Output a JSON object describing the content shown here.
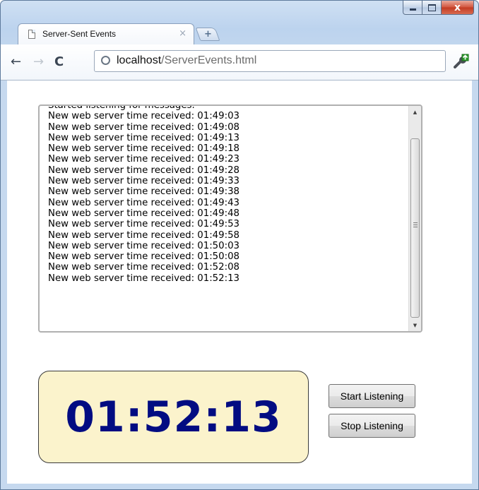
{
  "window": {
    "tab_title": "Server-Sent Events",
    "tab_close": "×",
    "new_tab": "+"
  },
  "toolbar": {
    "url_host": "localhost",
    "url_path": "/ServerEvents.html"
  },
  "log": {
    "lines": [
      "Started listening for messages.",
      "New web server time received: 01:49:03",
      "New web server time received: 01:49:08",
      "New web server time received: 01:49:13",
      "New web server time received: 01:49:18",
      "New web server time received: 01:49:23",
      "New web server time received: 01:49:28",
      "New web server time received: 01:49:33",
      "New web server time received: 01:49:38",
      "New web server time received: 01:49:43",
      "New web server time received: 01:49:48",
      "New web server time received: 01:49:53",
      "New web server time received: 01:49:58",
      "New web server time received: 01:50:03",
      "New web server time received: 01:50:08",
      "New web server time received: 01:52:08",
      "New web server time received: 01:52:13"
    ]
  },
  "clock": {
    "time": "01:52:13"
  },
  "buttons": {
    "start_label": "Start Listening",
    "stop_label": "Stop Listening"
  },
  "colors": {
    "clock_background": "#fbf3cc",
    "clock_text": "#020c82",
    "window_frame": "#bcd3ee",
    "close_button": "#c23a22"
  },
  "icons": [
    "page-icon",
    "back-arrow-icon",
    "forward-arrow-icon",
    "reload-icon",
    "globe-icon",
    "wrench-icon",
    "minimize-icon",
    "maximize-icon",
    "close-icon",
    "scroll-up-icon",
    "scroll-down-icon"
  ]
}
